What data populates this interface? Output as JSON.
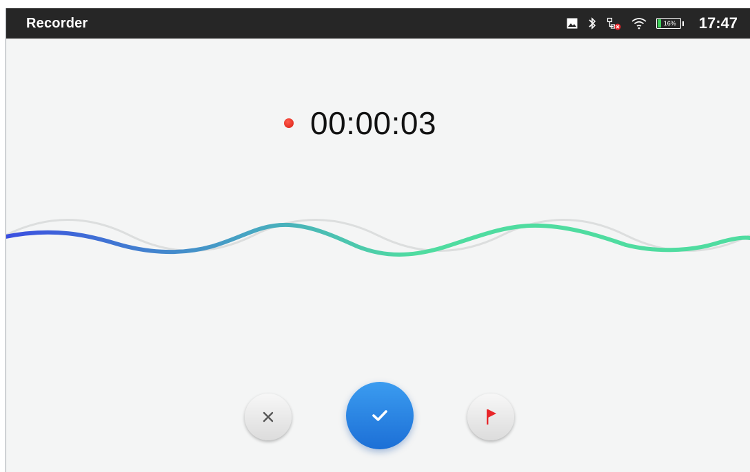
{
  "status_bar": {
    "app_title": "Recorder",
    "time": "17:47",
    "battery_percent": "16%",
    "battery_level": 0.16,
    "icons": [
      "image-icon",
      "bluetooth-icon",
      "network-disconnected-icon",
      "wifi-icon",
      "battery-icon"
    ]
  },
  "recording": {
    "elapsed": "00:00:03",
    "indicator": "recording-dot-icon"
  },
  "controls": {
    "cancel_icon": "close-icon",
    "done_icon": "check-icon",
    "flag_icon": "flag-icon"
  },
  "colors": {
    "status_bar": "#262626",
    "background": "#f4f5f5",
    "record_dot": "#e8261a",
    "wave_start": "#3b4fe0",
    "wave_mid": "#47a6c2",
    "wave_end": "#4fdca0",
    "done_button": "#2a84e4",
    "flag": "#e8262a"
  }
}
